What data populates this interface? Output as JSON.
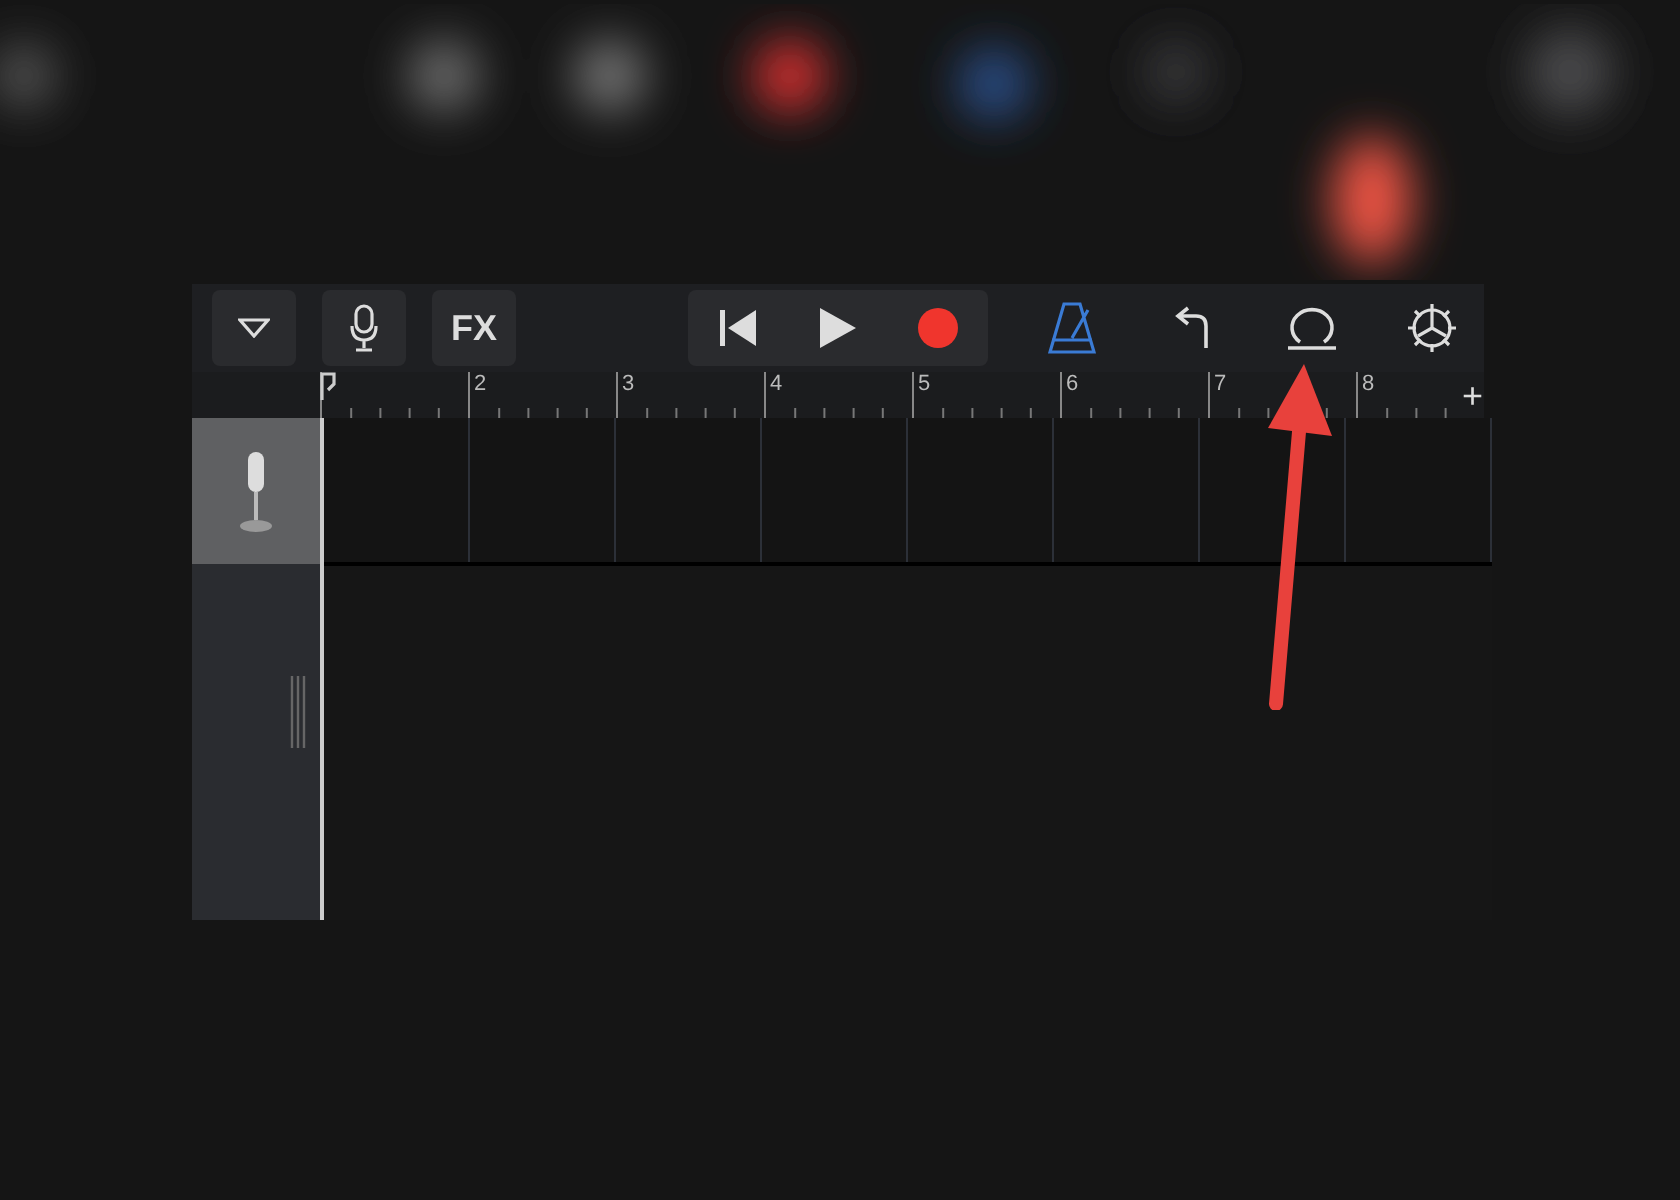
{
  "toolbar": {
    "left_buttons": [
      {
        "kind": "tracks-menu"
      },
      {
        "kind": "mic"
      },
      {
        "kind": "fx",
        "label": "FX"
      }
    ],
    "transport": [
      {
        "kind": "rewind"
      },
      {
        "kind": "play"
      },
      {
        "kind": "record"
      }
    ],
    "right_buttons": [
      {
        "kind": "metronome",
        "on": true
      },
      {
        "kind": "undo",
        "on": false
      },
      {
        "kind": "loop",
        "on": false
      },
      {
        "kind": "settings",
        "on": false
      }
    ]
  },
  "ruler": {
    "bars": [
      "2",
      "3",
      "4",
      "5",
      "6",
      "7",
      "8"
    ],
    "add_label": "+"
  },
  "tracks": [
    {
      "kind": "mic",
      "selected": true
    }
  ]
}
